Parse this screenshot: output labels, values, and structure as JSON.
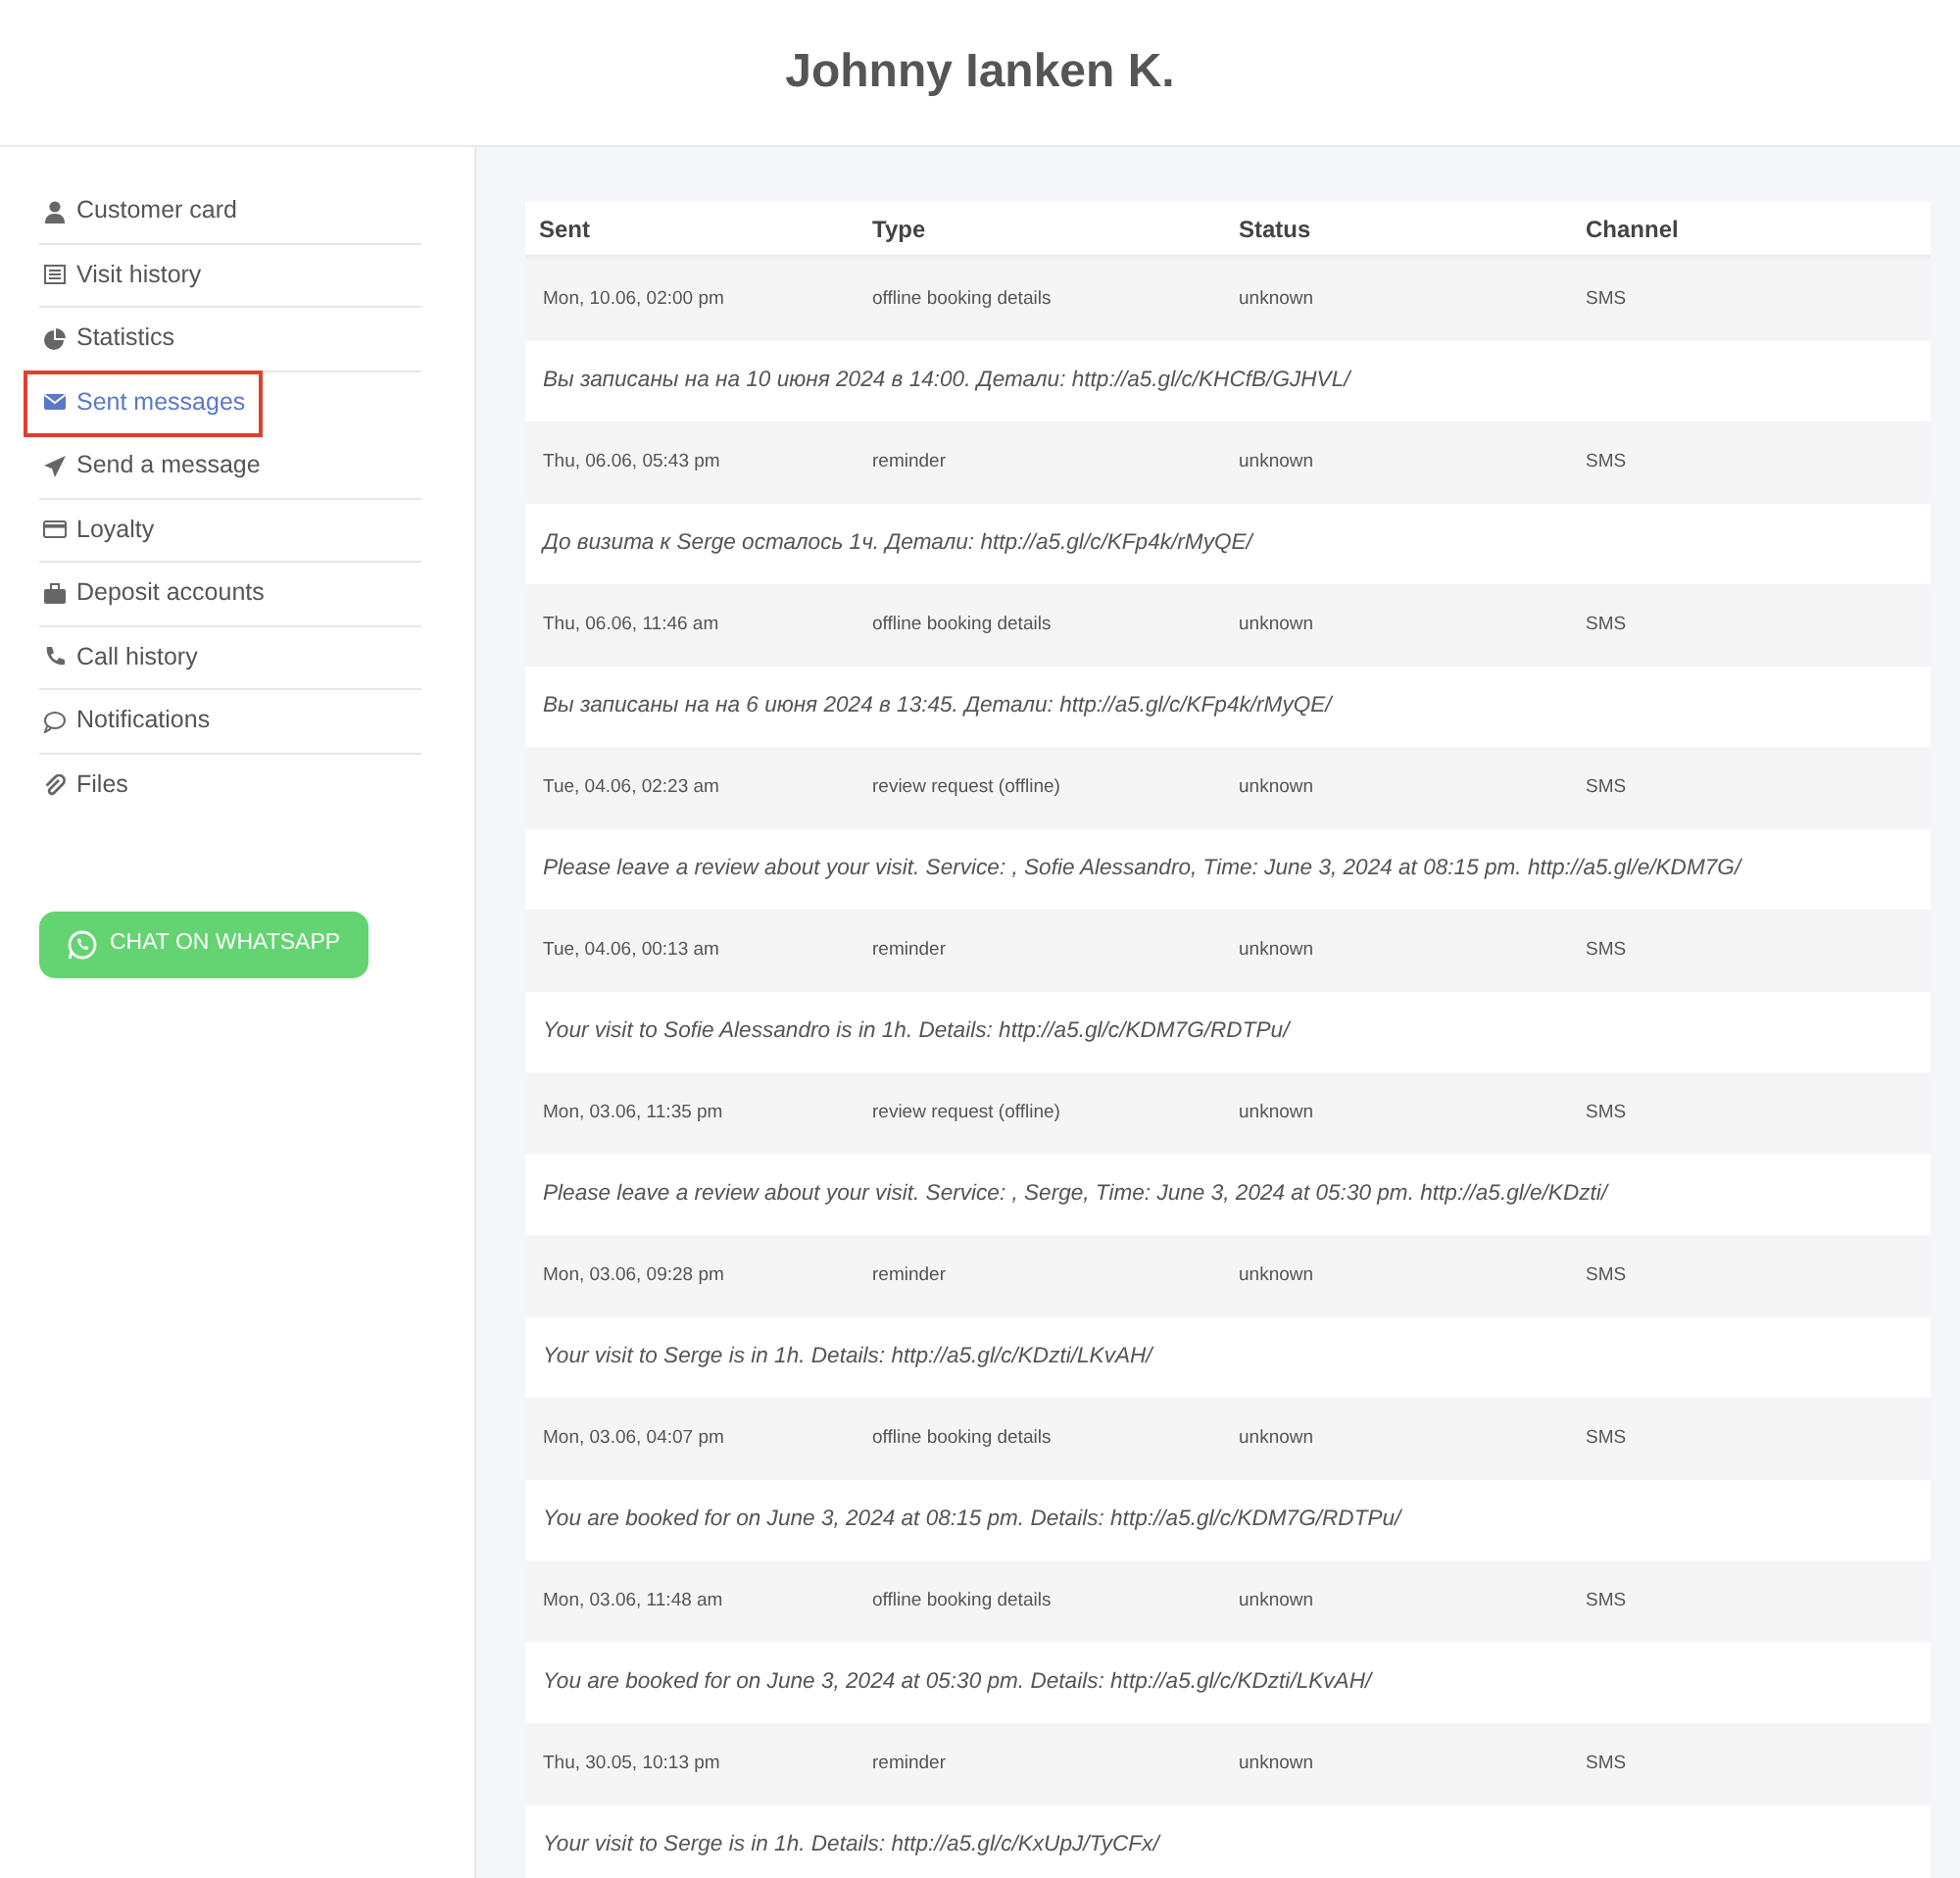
{
  "header": {
    "title": "Johnny Ianken K."
  },
  "sidebar": {
    "items": [
      {
        "label": "Customer card",
        "selected": false
      },
      {
        "label": "Visit history",
        "selected": false
      },
      {
        "label": "Statistics",
        "selected": false
      },
      {
        "label": "Sent messages",
        "selected": true
      },
      {
        "label": "Send a message",
        "selected": false
      },
      {
        "label": "Loyalty",
        "selected": false
      },
      {
        "label": "Deposit accounts",
        "selected": false
      },
      {
        "label": "Call history",
        "selected": false
      },
      {
        "label": "Notifications",
        "selected": false
      },
      {
        "label": "Files",
        "selected": false
      }
    ],
    "button": {
      "label": "CHAT ON WHATSAPP"
    }
  },
  "table": {
    "columns": [
      "Sent",
      "Type",
      "Status",
      "Channel"
    ],
    "rows": [
      {
        "sent": "Mon, 10.06, 02:00 pm",
        "type": "offline booking details",
        "status": "unknown",
        "channel": "SMS",
        "message": "Вы записаны на на 10 июня 2024 в 14:00. Детали: http://a5.gl/c/KHCfB/GJHVL/"
      },
      {
        "sent": "Thu, 06.06, 05:43 pm",
        "type": "reminder",
        "status": "unknown",
        "channel": "SMS",
        "message": "До визита к Serge осталось 1ч. Детали: http://a5.gl/c/KFp4k/rMyQE/"
      },
      {
        "sent": "Thu, 06.06, 11:46 am",
        "type": "offline booking details",
        "status": "unknown",
        "channel": "SMS",
        "message": "Вы записаны на на 6 июня 2024 в 13:45. Детали: http://a5.gl/c/KFp4k/rMyQE/"
      },
      {
        "sent": "Tue, 04.06, 02:23 am",
        "type": "review request (offline)",
        "status": "unknown",
        "channel": "SMS",
        "message": "Please leave a review about your visit. Service: , Sofie Alessandro, Time: June 3, 2024 at 08:15 pm. http://a5.gl/e/KDM7G/"
      },
      {
        "sent": "Tue, 04.06, 00:13 am",
        "type": "reminder",
        "status": "unknown",
        "channel": "SMS",
        "message": "Your visit to Sofie Alessandro is in 1h. Details: http://a5.gl/c/KDM7G/RDTPu/"
      },
      {
        "sent": "Mon, 03.06, 11:35 pm",
        "type": "review request (offline)",
        "status": "unknown",
        "channel": "SMS",
        "message": "Please leave a review about your visit. Service: , Serge, Time: June 3, 2024 at 05:30 pm. http://a5.gl/e/KDzti/"
      },
      {
        "sent": "Mon, 03.06, 09:28 pm",
        "type": "reminder",
        "status": "unknown",
        "channel": "SMS",
        "message": "Your visit to Serge is in 1h. Details: http://a5.gl/c/KDzti/LKvAH/"
      },
      {
        "sent": "Mon, 03.06, 04:07 pm",
        "type": "offline booking details",
        "status": "unknown",
        "channel": "SMS",
        "message": "You are booked for on June 3, 2024 at 08:15 pm. Details: http://a5.gl/c/KDM7G/RDTPu/"
      },
      {
        "sent": "Mon, 03.06, 11:48 am",
        "type": "offline booking details",
        "status": "unknown",
        "channel": "SMS",
        "message": "You are booked for on June 3, 2024 at 05:30 pm. Details: http://a5.gl/c/KDzti/LKvAH/"
      },
      {
        "sent": "Thu, 30.05, 10:13 pm",
        "type": "reminder",
        "status": "unknown",
        "channel": "SMS",
        "message": "Your visit to Serge is in 1h. Details: http://a5.gl/c/KxUpJ/TyCFx/"
      }
    ]
  }
}
